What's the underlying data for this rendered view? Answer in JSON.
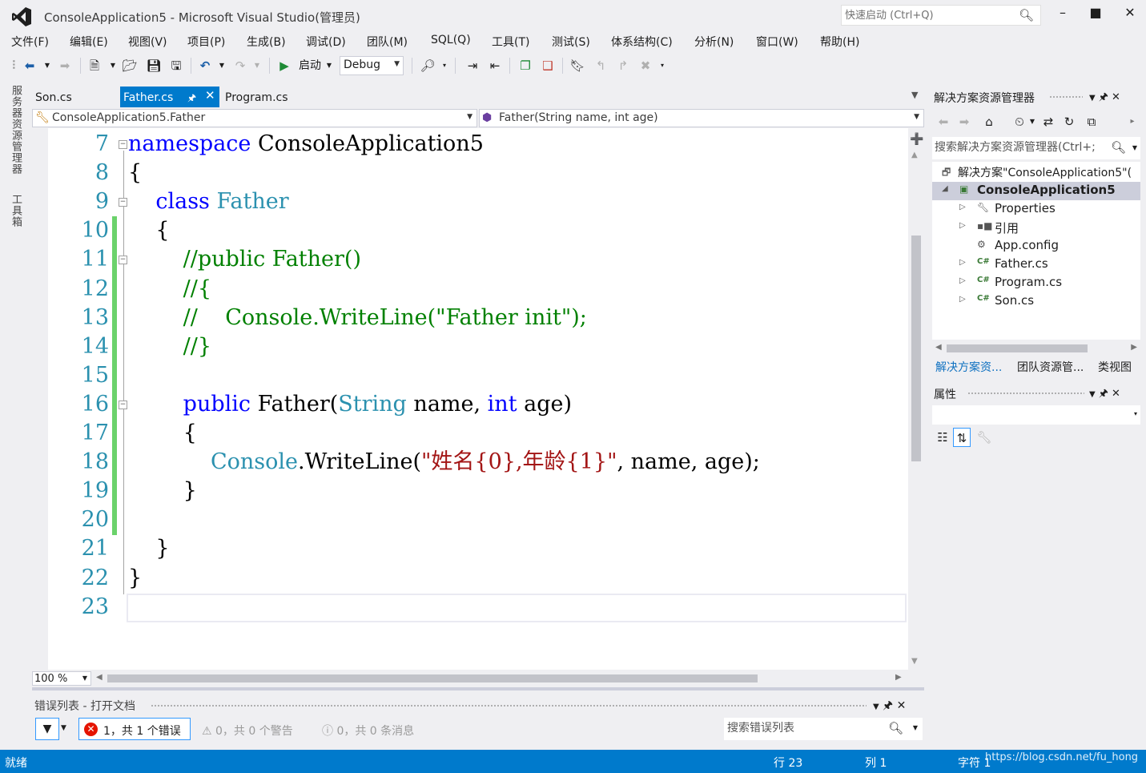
{
  "window": {
    "title": "ConsoleApplication5 - Microsoft Visual Studio(管理员)",
    "quick_launch_placeholder": "快速启动 (Ctrl+Q)",
    "controls": {
      "minimize": "–",
      "maximize": "■",
      "close": "✕"
    }
  },
  "menu": [
    "文件(F)",
    "编辑(E)",
    "视图(V)",
    "项目(P)",
    "生成(B)",
    "调试(D)",
    "团队(M)",
    "SQL(Q)",
    "工具(T)",
    "测试(S)",
    "体系结构(C)",
    "分析(N)",
    "窗口(W)",
    "帮助(H)"
  ],
  "toolbar": {
    "start_label": "启动",
    "configuration": "Debug"
  },
  "left_tabs": [
    "服务器资源管理器",
    "工具箱"
  ],
  "doc_tabs": [
    {
      "label": "Son.cs",
      "active": false
    },
    {
      "label": "Father.cs",
      "active": true
    },
    {
      "label": "Program.cs",
      "active": false
    }
  ],
  "nav": {
    "type_scope": "ConsoleApplication5.Father",
    "member_scope": "Father(String name, int age)"
  },
  "code_lines": [
    {
      "no": "7",
      "fold": "−",
      "tokens": [
        {
          "t": "namespace",
          "c": "kw"
        },
        {
          "t": " ConsoleApplication5",
          "c": ""
        }
      ]
    },
    {
      "no": "8",
      "fold": "",
      "tokens": [
        {
          "t": "{",
          "c": ""
        }
      ]
    },
    {
      "no": "9",
      "fold": "−",
      "tokens": [
        {
          "t": "    ",
          "c": ""
        },
        {
          "t": "class",
          "c": "kw"
        },
        {
          "t": " ",
          "c": ""
        },
        {
          "t": "Father",
          "c": "ty"
        }
      ]
    },
    {
      "no": "10",
      "fold": "",
      "tokens": [
        {
          "t": "    {",
          "c": ""
        }
      ]
    },
    {
      "no": "11",
      "fold": "−",
      "tokens": [
        {
          "t": "        ",
          "c": ""
        },
        {
          "t": "//public Father()",
          "c": "cm"
        }
      ]
    },
    {
      "no": "12",
      "fold": "",
      "tokens": [
        {
          "t": "        ",
          "c": ""
        },
        {
          "t": "//{",
          "c": "cm"
        }
      ]
    },
    {
      "no": "13",
      "fold": "",
      "tokens": [
        {
          "t": "        ",
          "c": ""
        },
        {
          "t": "//    Console.WriteLine(\"Father init\");",
          "c": "cm"
        }
      ]
    },
    {
      "no": "14",
      "fold": "",
      "tokens": [
        {
          "t": "        ",
          "c": ""
        },
        {
          "t": "//}",
          "c": "cm"
        }
      ]
    },
    {
      "no": "15",
      "fold": "",
      "tokens": []
    },
    {
      "no": "16",
      "fold": "−",
      "tokens": [
        {
          "t": "        ",
          "c": ""
        },
        {
          "t": "public",
          "c": "kw"
        },
        {
          "t": " Father(",
          "c": ""
        },
        {
          "t": "String",
          "c": "ty"
        },
        {
          "t": " name, ",
          "c": ""
        },
        {
          "t": "int",
          "c": "kw"
        },
        {
          "t": " age)",
          "c": ""
        }
      ]
    },
    {
      "no": "17",
      "fold": "",
      "tokens": [
        {
          "t": "        {",
          "c": ""
        }
      ]
    },
    {
      "no": "18",
      "fold": "",
      "tokens": [
        {
          "t": "            ",
          "c": ""
        },
        {
          "t": "Console",
          "c": "ty"
        },
        {
          "t": ".WriteLine(",
          "c": ""
        },
        {
          "t": "\"姓名{0},年龄{1}\"",
          "c": "st"
        },
        {
          "t": ", name, age);",
          "c": ""
        }
      ]
    },
    {
      "no": "19",
      "fold": "",
      "tokens": [
        {
          "t": "        }",
          "c": ""
        }
      ]
    },
    {
      "no": "20",
      "fold": "",
      "tokens": []
    },
    {
      "no": "21",
      "fold": "",
      "tokens": [
        {
          "t": "    }",
          "c": ""
        }
      ]
    },
    {
      "no": "22",
      "fold": "",
      "tokens": [
        {
          "t": "}",
          "c": ""
        }
      ]
    },
    {
      "no": "23",
      "fold": "",
      "tokens": []
    }
  ],
  "syntax_colors": {
    "keyword": "#0000ff",
    "type": "#2b91af",
    "comment": "#008000",
    "string": "#a31515",
    "line_number": "#2b91af"
  },
  "zoom": "100 %",
  "error_list": {
    "title": "错误列表 - 打开文档",
    "errors": "1，共 1 个错误",
    "warnings": "0，共 0 个警告",
    "messages": "0，共 0 条消息",
    "search_placeholder": "搜索错误列表"
  },
  "solution_explorer": {
    "title": "解决方案资源管理器",
    "search_placeholder": "搜索解决方案资源管理器(Ctrl+;",
    "solution": "解决方案\"ConsoleApplication5\"(",
    "project": "ConsoleApplication5",
    "items": [
      {
        "label": "Properties",
        "icon": "wrench-icon",
        "expand": true
      },
      {
        "label": "引用",
        "icon": "references-icon",
        "expand": true
      },
      {
        "label": "App.config",
        "icon": "config-file-icon",
        "expand": false
      },
      {
        "label": "Father.cs",
        "icon": "csharp-file-icon",
        "expand": true
      },
      {
        "label": "Program.cs",
        "icon": "csharp-file-icon",
        "expand": true
      },
      {
        "label": "Son.cs",
        "icon": "csharp-file-icon",
        "expand": true
      }
    ],
    "tabs": [
      "解决方案资...",
      "团队资源管...",
      "类视图"
    ]
  },
  "properties": {
    "title": "属性"
  },
  "status": {
    "ready": "就绪",
    "line": "行 23",
    "col": "列 1",
    "char": "字符 1",
    "watermark": "https://blog.csdn.net/fu_hong"
  },
  "accent_color": "#007acc"
}
